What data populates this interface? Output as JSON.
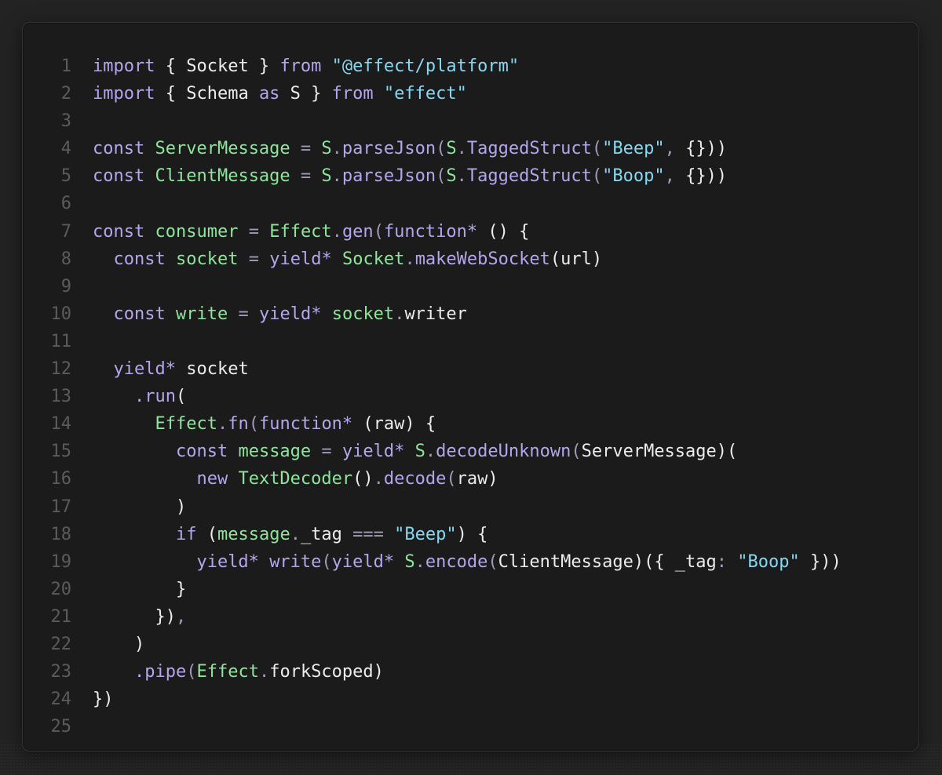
{
  "colors": {
    "keyword": "#b5a6ec",
    "identifier": "#8fe59c",
    "string": "#86d8f2",
    "punctuation": "#a09ab8",
    "text": "#ececec",
    "line_number": "#5b5b5b",
    "background": "#1b1b1b"
  },
  "lines": [
    [
      [
        "kw",
        "import"
      ],
      [
        "tx",
        " { Socket } "
      ],
      [
        "kw",
        "from"
      ],
      [
        "tx",
        " "
      ],
      [
        "str",
        "\"@effect/platform\""
      ]
    ],
    [
      [
        "kw",
        "import"
      ],
      [
        "tx",
        " { Schema "
      ],
      [
        "kw",
        "as"
      ],
      [
        "tx",
        " S } "
      ],
      [
        "kw",
        "from"
      ],
      [
        "tx",
        " "
      ],
      [
        "str",
        "\"effect\""
      ]
    ],
    [],
    [
      [
        "kw",
        "const"
      ],
      [
        "tx",
        " "
      ],
      [
        "id",
        "ServerMessage"
      ],
      [
        "tx",
        " "
      ],
      [
        "pn",
        "="
      ],
      [
        "tx",
        " "
      ],
      [
        "id",
        "S"
      ],
      [
        "pn",
        "."
      ],
      [
        "kw",
        "parseJson"
      ],
      [
        "pn",
        "("
      ],
      [
        "id",
        "S"
      ],
      [
        "pn",
        "."
      ],
      [
        "kw",
        "TaggedStruct"
      ],
      [
        "pn",
        "("
      ],
      [
        "str",
        "\"Beep\""
      ],
      [
        "pn",
        ","
      ],
      [
        "tx",
        " {}))"
      ]
    ],
    [
      [
        "kw",
        "const"
      ],
      [
        "tx",
        " "
      ],
      [
        "id",
        "ClientMessage"
      ],
      [
        "tx",
        " "
      ],
      [
        "pn",
        "="
      ],
      [
        "tx",
        " "
      ],
      [
        "id",
        "S"
      ],
      [
        "pn",
        "."
      ],
      [
        "kw",
        "parseJson"
      ],
      [
        "pn",
        "("
      ],
      [
        "id",
        "S"
      ],
      [
        "pn",
        "."
      ],
      [
        "kw",
        "TaggedStruct"
      ],
      [
        "pn",
        "("
      ],
      [
        "str",
        "\"Boop\""
      ],
      [
        "pn",
        ","
      ],
      [
        "tx",
        " {}))"
      ]
    ],
    [],
    [
      [
        "kw",
        "const"
      ],
      [
        "tx",
        " "
      ],
      [
        "id",
        "consumer"
      ],
      [
        "tx",
        " "
      ],
      [
        "pn",
        "="
      ],
      [
        "tx",
        " "
      ],
      [
        "id",
        "Effect"
      ],
      [
        "pn",
        "."
      ],
      [
        "kw",
        "gen"
      ],
      [
        "pn",
        "("
      ],
      [
        "kw",
        "function*"
      ],
      [
        "tx",
        " () {"
      ]
    ],
    [
      [
        "tx",
        "  "
      ],
      [
        "kw",
        "const"
      ],
      [
        "tx",
        " "
      ],
      [
        "id",
        "socket"
      ],
      [
        "tx",
        " "
      ],
      [
        "pn",
        "="
      ],
      [
        "tx",
        " "
      ],
      [
        "kw",
        "yield*"
      ],
      [
        "tx",
        " "
      ],
      [
        "id",
        "Socket"
      ],
      [
        "pn",
        "."
      ],
      [
        "kw",
        "makeWebSocket"
      ],
      [
        "tx",
        "(url)"
      ]
    ],
    [],
    [
      [
        "tx",
        "  "
      ],
      [
        "kw",
        "const"
      ],
      [
        "tx",
        " "
      ],
      [
        "id",
        "write"
      ],
      [
        "tx",
        " "
      ],
      [
        "pn",
        "="
      ],
      [
        "tx",
        " "
      ],
      [
        "kw",
        "yield*"
      ],
      [
        "tx",
        " "
      ],
      [
        "id",
        "socket"
      ],
      [
        "pn",
        "."
      ],
      [
        "tx",
        "writer"
      ]
    ],
    [],
    [
      [
        "tx",
        "  "
      ],
      [
        "kw",
        "yield*"
      ],
      [
        "tx",
        " socket"
      ]
    ],
    [
      [
        "tx",
        "    "
      ],
      [
        "kw",
        ".run"
      ],
      [
        "tx",
        "("
      ]
    ],
    [
      [
        "tx",
        "      "
      ],
      [
        "id",
        "Effect"
      ],
      [
        "pn",
        "."
      ],
      [
        "kw",
        "fn"
      ],
      [
        "pn",
        "("
      ],
      [
        "kw",
        "function*"
      ],
      [
        "tx",
        " (raw) {"
      ]
    ],
    [
      [
        "tx",
        "        "
      ],
      [
        "kw",
        "const"
      ],
      [
        "tx",
        " "
      ],
      [
        "id",
        "message"
      ],
      [
        "tx",
        " "
      ],
      [
        "pn",
        "="
      ],
      [
        "tx",
        " "
      ],
      [
        "kw",
        "yield*"
      ],
      [
        "tx",
        " "
      ],
      [
        "id",
        "S"
      ],
      [
        "pn",
        "."
      ],
      [
        "kw",
        "decodeUnknown"
      ],
      [
        "pn",
        "("
      ],
      [
        "tx",
        "ServerMessage)("
      ]
    ],
    [
      [
        "tx",
        "          "
      ],
      [
        "kw",
        "new"
      ],
      [
        "tx",
        " "
      ],
      [
        "id",
        "TextDecoder"
      ],
      [
        "tx",
        "()"
      ],
      [
        "pn",
        "."
      ],
      [
        "kw",
        "decode"
      ],
      [
        "pn",
        "("
      ],
      [
        "tx",
        "raw)"
      ]
    ],
    [
      [
        "tx",
        "        )"
      ]
    ],
    [
      [
        "tx",
        "        "
      ],
      [
        "kw",
        "if"
      ],
      [
        "tx",
        " ("
      ],
      [
        "id",
        "message"
      ],
      [
        "pn",
        "."
      ],
      [
        "tx",
        "_tag "
      ],
      [
        "pn",
        "==="
      ],
      [
        "tx",
        " "
      ],
      [
        "str",
        "\"Beep\""
      ],
      [
        "tx",
        ") {"
      ]
    ],
    [
      [
        "tx",
        "          "
      ],
      [
        "kw",
        "yield*"
      ],
      [
        "tx",
        " "
      ],
      [
        "kw",
        "write"
      ],
      [
        "pn",
        "("
      ],
      [
        "kw",
        "yield*"
      ],
      [
        "tx",
        " "
      ],
      [
        "id",
        "S"
      ],
      [
        "pn",
        "."
      ],
      [
        "kw",
        "encode"
      ],
      [
        "pn",
        "("
      ],
      [
        "tx",
        "ClientMessage)({ _tag"
      ],
      [
        "pn",
        ":"
      ],
      [
        "tx",
        " "
      ],
      [
        "str",
        "\"Boop\""
      ],
      [
        "tx",
        " }))"
      ]
    ],
    [
      [
        "tx",
        "        }"
      ]
    ],
    [
      [
        "tx",
        "      })"
      ],
      [
        "pn",
        ","
      ]
    ],
    [
      [
        "tx",
        "    )"
      ]
    ],
    [
      [
        "tx",
        "    "
      ],
      [
        "kw",
        ".pipe"
      ],
      [
        "pn",
        "("
      ],
      [
        "id",
        "Effect"
      ],
      [
        "pn",
        "."
      ],
      [
        "tx",
        "forkScoped)"
      ]
    ],
    [
      [
        "tx",
        "})"
      ]
    ],
    []
  ]
}
